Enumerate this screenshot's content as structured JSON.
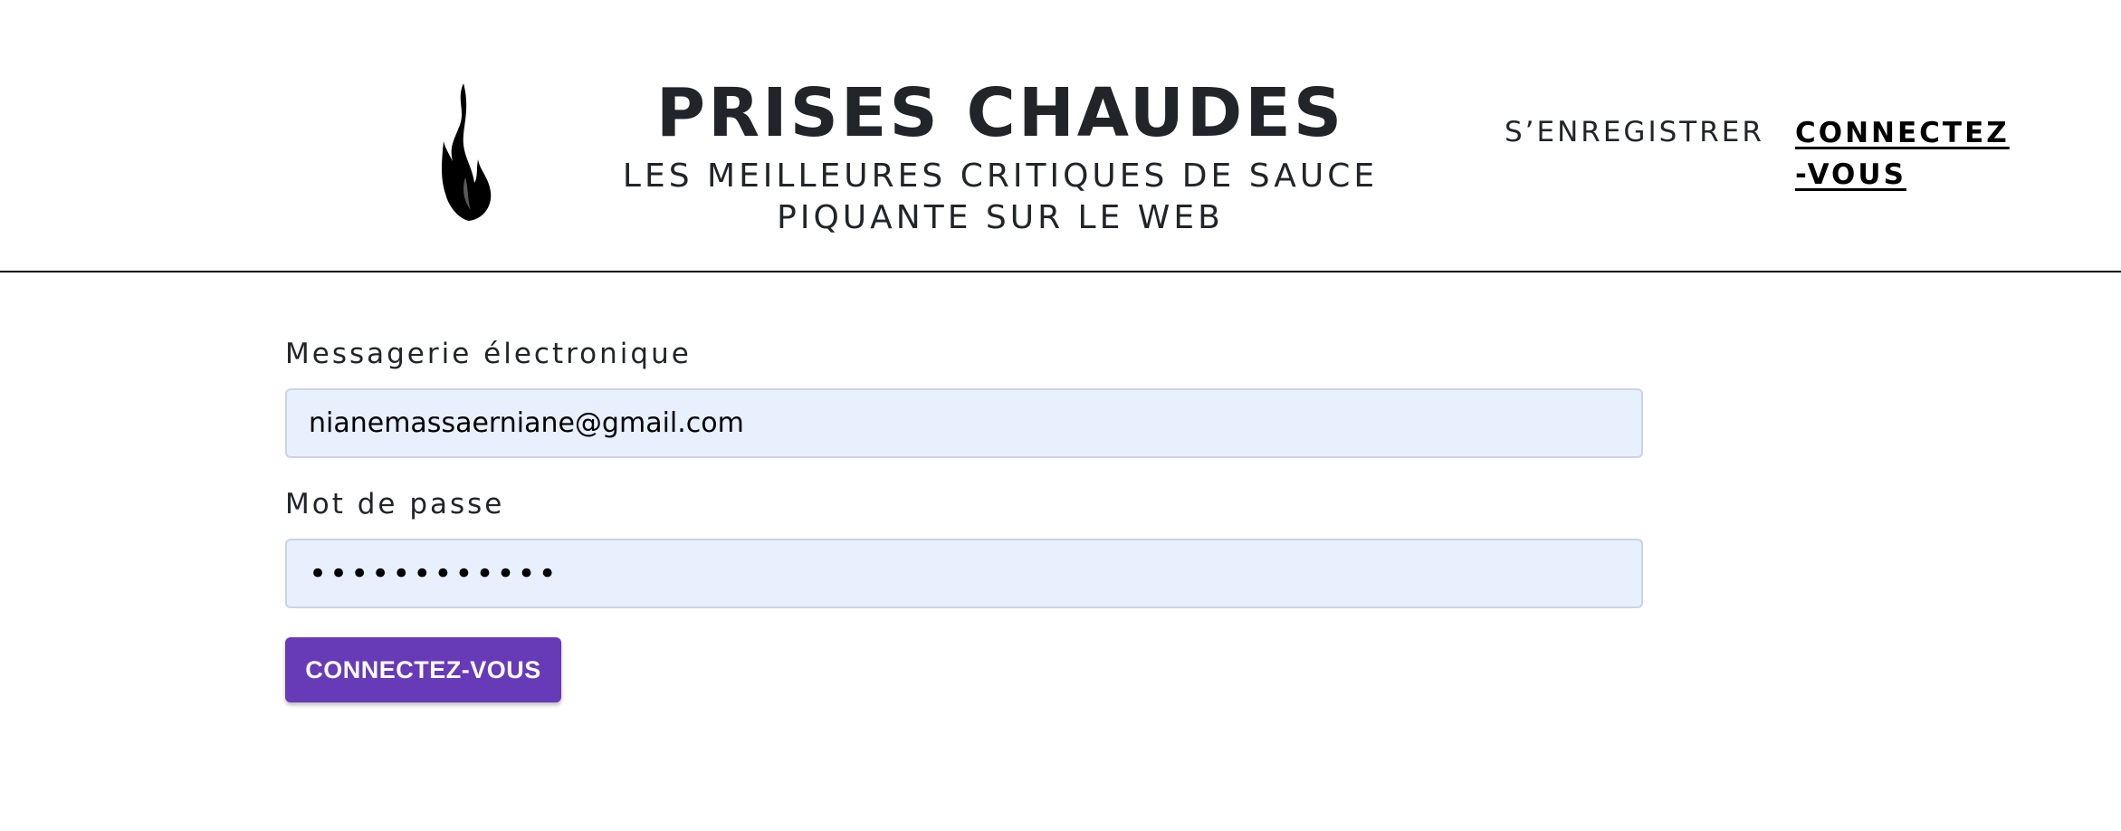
{
  "header": {
    "logo_icon": "flame-icon",
    "title": "PRISES CHAUDES",
    "subtitle": "LES MEILLEURES CRITIQUES DE SAUCE PIQUANTE SUR LE WEB"
  },
  "nav": {
    "register_label": "S’ENREGISTRER",
    "login_label": "CONNECTEZ-VOUS"
  },
  "login_form": {
    "email_label": "Messagerie électronique",
    "email_value": "nianemassaerniane@gmail.com",
    "password_label": "Mot de passe",
    "password_value": "••••••••••••",
    "submit_label": "CONNECTEZ-VOUS"
  },
  "colors": {
    "accent": "#673ab7",
    "input_background": "#e8f0fe",
    "text": "#212529"
  }
}
